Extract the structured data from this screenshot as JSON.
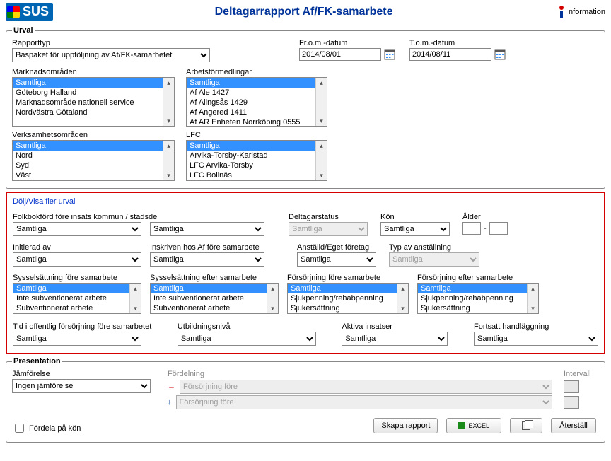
{
  "header": {
    "logo_text": "SUS",
    "title": "Deltagarrapport Af/FK-samarbete",
    "info_label": "nformation"
  },
  "urval": {
    "legend": "Urval",
    "rapporttyp_label": "Rapporttyp",
    "rapporttyp_value": "Baspaket för uppföljning av Af/FK-samarbetet",
    "from_label": "Fr.o.m.-datum",
    "from_value": "2014/08/01",
    "tom_label": "T.o.m.-datum",
    "tom_value": "2014/08/11",
    "marknad_label": "Marknadsområden",
    "marknad_items": [
      "Samtliga",
      "Göteborg Halland",
      "Marknadsområde nationell service",
      "Nordvästra Götaland"
    ],
    "arbetsf_label": "Arbetsförmedlingar",
    "arbetsf_items": [
      "Samtliga",
      "Af Ale 1427",
      "Af Alingsås 1429",
      "Af Angered 1411",
      "Af AR Enheten Norrköping 0555"
    ],
    "verksamhet_label": "Verksamhetsområden",
    "verksamhet_items": [
      "Samtliga",
      "Nord",
      "Syd",
      "Väst"
    ],
    "lfc_label": "LFC",
    "lfc_items": [
      "Samtliga",
      "Arvika-Torsby-Karlstad",
      "LFC Arvika-Torsby",
      "LFC Bollnäs"
    ]
  },
  "extra": {
    "toggle_label": "Dölj/Visa fler urval",
    "folk_label": "Folkbokförd före insats kommun / stadsdel",
    "folk_value": "Samtliga",
    "folk_value2": "Samtliga",
    "deltagarstatus_label": "Deltagarstatus",
    "deltagarstatus_value": "Samtliga",
    "kon_label": "Kön",
    "kon_value": "Samtliga",
    "alder_label": "Ålder",
    "initierad_label": "Initierad av",
    "initierad_value": "Samtliga",
    "inskriven_label": "Inskriven hos Af före samarbete",
    "inskriven_value": "Samtliga",
    "anstalld_label": "Anställd/Eget företag",
    "anstalld_value": "Samtliga",
    "typ_anst_label": "Typ av anställning",
    "typ_anst_value": "Samtliga",
    "syssel_fore_label": "Sysselsättning före samarbete",
    "syssel_fore_items": [
      "Samtliga",
      "Inte subventionerat arbete",
      "Subventionerat arbete"
    ],
    "syssel_efter_label": "Sysselsättning efter samarbete",
    "syssel_efter_items": [
      "Samtliga",
      "Inte subventionerat arbete",
      "Subventionerat arbete"
    ],
    "fors_fore_label": "Försörjning före samarbete",
    "fors_fore_items": [
      "Samtliga",
      "Sjukpenning/rehabpenning",
      "Sjukersättning"
    ],
    "fors_efter_label": "Försörjning efter samarbete",
    "fors_efter_items": [
      "Samtliga",
      "Sjukpenning/rehabpenning",
      "Sjukersättning"
    ],
    "tid_label": "Tid i offentlig försörjning före samarbetet",
    "tid_value": "Samtliga",
    "utb_label": "Utbildningsnivå",
    "utb_value": "Samtliga",
    "aktiva_label": "Aktiva insatser",
    "aktiva_value": "Samtliga",
    "fortsatt_label": "Fortsatt handläggning",
    "fortsatt_value": "Samtliga"
  },
  "presentation": {
    "legend": "Presentation",
    "jamforelse_label": "Jämförelse",
    "jamforelse_value": "Ingen jämförelse",
    "fordelning_label": "Fördelning",
    "fordelning_value": "Försörjning före",
    "fordelning_value2": "Försörjning före",
    "intervall_label": "Intervall",
    "fordela_label": "Fördela på kön",
    "btn_skapa": "Skapa rapport",
    "btn_excel": "EXCEL",
    "btn_aterstall": "Återställ"
  }
}
